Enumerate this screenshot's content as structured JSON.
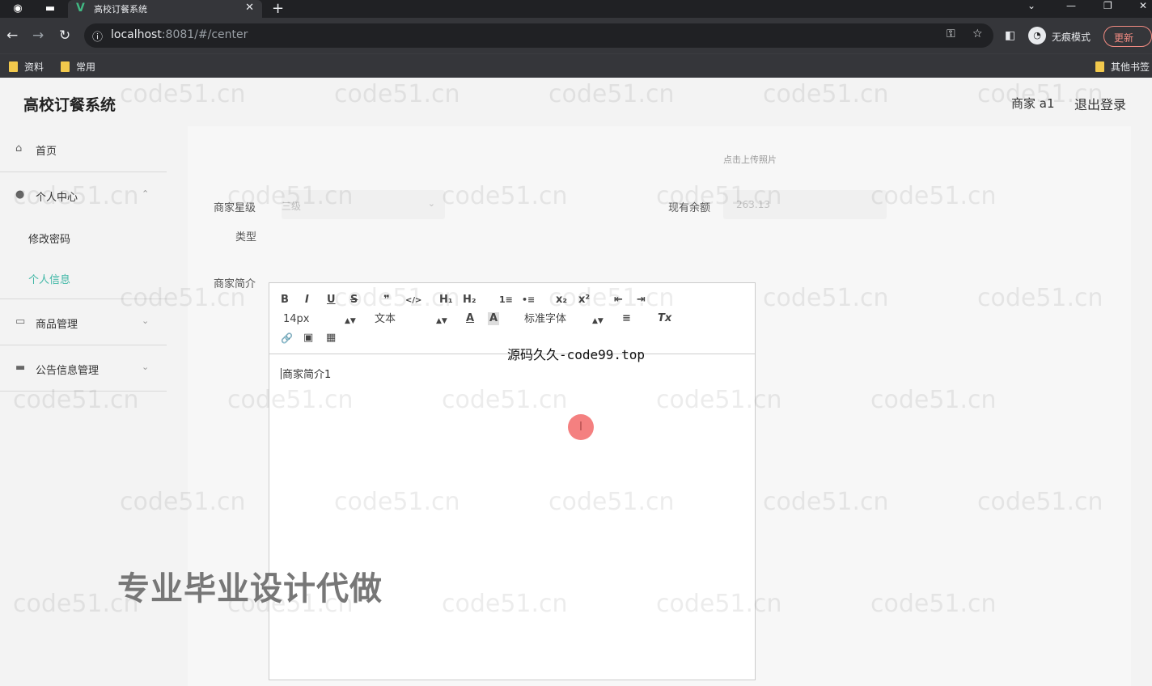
{
  "browser": {
    "tab_title": "高校订餐系统",
    "tab_close": "✕",
    "new_tab": "+",
    "url_host": "localhost",
    "url_rest": ":8081/#/center",
    "incognito_label": "无痕模式",
    "update_label": "更新",
    "bookmarks": [
      "资料",
      "常用"
    ],
    "other_bookmarks": "其他书签"
  },
  "app": {
    "title": "高校订餐系统",
    "user": "商家 a1",
    "logout": "退出登录"
  },
  "sidebar": {
    "home": "首页",
    "personal_center": "个人中心",
    "change_password": "修改密码",
    "personal_info": "个人信息",
    "product_mgmt": "商品管理",
    "notice_mgmt": "公告信息管理"
  },
  "form": {
    "upload_hint": "点击上传照片",
    "level_label": "商家星级",
    "level_value": "三级",
    "balance_label": "现有余额",
    "balance_value": "263.13",
    "type_label": "类型",
    "intro_label": "商家简介",
    "intro_text": "商家简介1"
  },
  "editor": {
    "font_size": "14px",
    "header_style": "文本",
    "font_family": "标准字体",
    "buttons": {
      "bold": "B",
      "italic": "I",
      "underline": "U",
      "strike": "S",
      "quote": "❞",
      "code": "</>",
      "h1": "H₁",
      "h2": "H₂",
      "ol": "1≡",
      "ul": "•≡",
      "sub": "x₂",
      "sup": "x²",
      "outdent": "⇤",
      "indent": "⇥",
      "color": "A",
      "bg": "A",
      "align": "≡",
      "clean": "Tx",
      "link": "🔗",
      "image": "▣",
      "video": "▦"
    }
  },
  "overlays": {
    "center_text": "源码久久-code99.top",
    "big_text": "专业毕业设计代做",
    "watermark": "code51.cn"
  }
}
